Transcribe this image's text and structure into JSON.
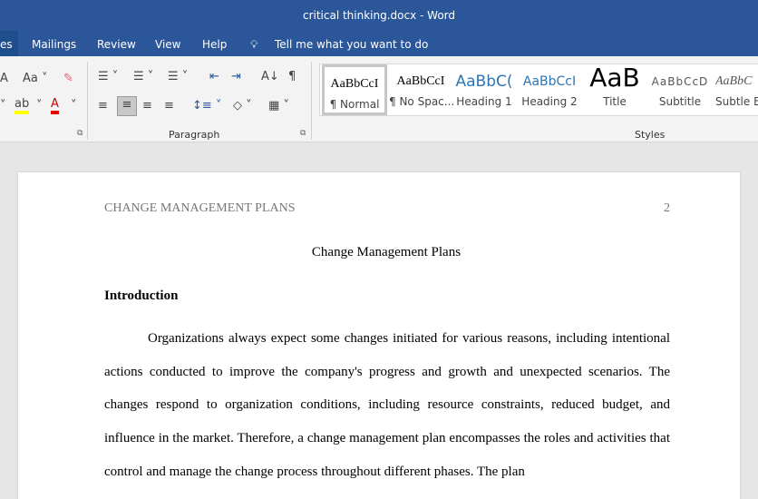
{
  "window": {
    "title": "critical thinking.docx  -  Word"
  },
  "tabs": [
    {
      "label": "es"
    },
    {
      "label": "Mailings"
    },
    {
      "label": "Review"
    },
    {
      "label": "View"
    },
    {
      "label": "Help"
    }
  ],
  "tell_me": {
    "label": "Tell me what you want to do"
  },
  "ribbon": {
    "font_icons": {
      "case": "Aa",
      "text_highlight_color": "#ffff00",
      "font_color": "#e00000"
    },
    "paragraph_group": "Paragraph",
    "styles_group": "Styles",
    "pilcrow": "¶",
    "styles": [
      {
        "preview": "AaBbCcI",
        "label": "¶ Normal",
        "selected": true
      },
      {
        "preview": "AaBbCcI",
        "label": "¶ No Spac..."
      },
      {
        "preview": "AaBbC(",
        "label": "Heading 1"
      },
      {
        "preview": "AaBbCcI",
        "label": "Heading 2"
      },
      {
        "preview": "AaB",
        "label": "Title"
      },
      {
        "preview": "AaBbCcD",
        "label": "Subtitle"
      },
      {
        "preview": "AaBbC",
        "label": "Subtle Em"
      }
    ]
  },
  "document": {
    "running_head": "CHANGE MANAGEMENT PLANS",
    "page_number": "2",
    "title": "Change Management Plans",
    "heading": "Introduction",
    "paragraph": "Organizations always expect some changes initiated for various reasons, including intentional actions conducted to improve the company's progress and growth and unexpected scenarios. The changes respond to organization conditions, including resource constraints, reduced budget, and influence in the market. Therefore, a change management plan encompasses the roles and activities that control and manage the change process throughout different phases. The plan"
  }
}
